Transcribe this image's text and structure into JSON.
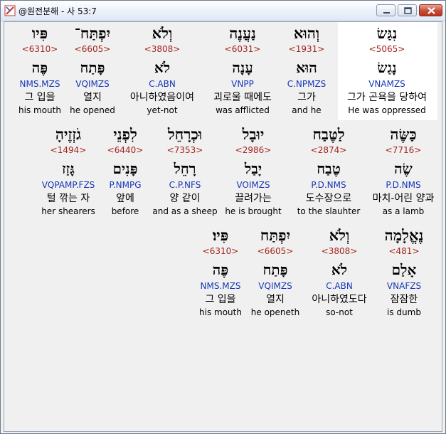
{
  "window": {
    "title": "@원전분해 - 사 53:7"
  },
  "rows": [
    {
      "words": [
        {
          "hebrew": "נִגַּשׂ",
          "strong": "<5065>",
          "lemma": "נָגַשׂ",
          "parse": "VNAMZS",
          "korean": "그가 곤욕을 당하여",
          "english": "He was oppressed",
          "selected": true
        },
        {
          "hebrew": "וְהוּא",
          "strong": "<1931>",
          "lemma": "הוּא",
          "parse": "C.NPMZS",
          "korean": "그가",
          "english": "and he"
        },
        {
          "hebrew": "נַעֲנֶה",
          "strong": "<6031>",
          "lemma": "עָנָה",
          "parse": "VNPP",
          "korean": "괴로울 때에도",
          "english": "was afflicted"
        },
        {
          "hebrew": "וְלֹא",
          "strong": "<3808>",
          "lemma": "לֹא",
          "parse": "C.ABN",
          "korean": "아니하였음이여",
          "english": "yet-not"
        },
        {
          "hebrew": "יִפְתַּח־",
          "strong": "<6605>",
          "lemma": "פָּתַח",
          "parse": "VQIMZS",
          "korean": "열지",
          "english": "he opened"
        },
        {
          "hebrew": "פִּיו",
          "strong": "<6310>",
          "lemma": "פֶּה",
          "parse": "NMS.MZS",
          "korean": "그 입을",
          "english": "his mouth"
        }
      ]
    },
    {
      "words": [
        {
          "hebrew": "כַּשֶּׂה",
          "strong": "<7716>",
          "lemma": "שֶׂה",
          "parse": "P.D.NMS",
          "korean": "마치-어린 양과",
          "english": "as a lamb"
        },
        {
          "hebrew": "לַטֶּבַח",
          "strong": "<2874>",
          "lemma": "טֶבַח",
          "parse": "P.D.NMS",
          "korean": "도수장으로",
          "english": "to the slauhter"
        },
        {
          "hebrew": "יוּבָל",
          "strong": "<2986>",
          "lemma": "יָבַל",
          "parse": "VOIMZS",
          "korean": "끌려가는",
          "english": "he is brought"
        },
        {
          "hebrew": "וּכְרָחֵל",
          "strong": "<7353>",
          "lemma": "רָחֵל",
          "parse": "C.P.NFS",
          "korean": "양 같이",
          "english": "and as a sheep"
        },
        {
          "hebrew": "לִפְנֵי",
          "strong": "<6440>",
          "lemma": "פָּנִים",
          "parse": "P.NMPG",
          "korean": "앞에",
          "english": "before"
        },
        {
          "hebrew": "גֹזְזֶיהָ",
          "strong": "<1494>",
          "lemma": "גָּזַז",
          "parse": "VQPAMP.FZS",
          "korean": "털 깎는 자",
          "english": "her shearers"
        }
      ]
    },
    {
      "words": [
        {
          "hebrew": "נֶאֱלָמָה",
          "strong": "<481>",
          "lemma": "אָלַם",
          "parse": "VNAFZS",
          "korean": "잠잠한",
          "english": "is dumb"
        },
        {
          "hebrew": "וְלֹא",
          "strong": "<3808>",
          "lemma": "לֹא",
          "parse": "C.ABN",
          "korean": "아니하였도다",
          "english": "so-not"
        },
        {
          "hebrew": "יִפְתַּח",
          "strong": "<6605>",
          "lemma": "פָּתַח",
          "parse": "VQIMZS",
          "korean": "열지",
          "english": "he openeth"
        },
        {
          "hebrew": "פִּיו׃",
          "strong": "<6310>",
          "lemma": "פֶּה",
          "parse": "NMS.MZS",
          "korean": "그 입을",
          "english": "his mouth"
        }
      ]
    }
  ]
}
